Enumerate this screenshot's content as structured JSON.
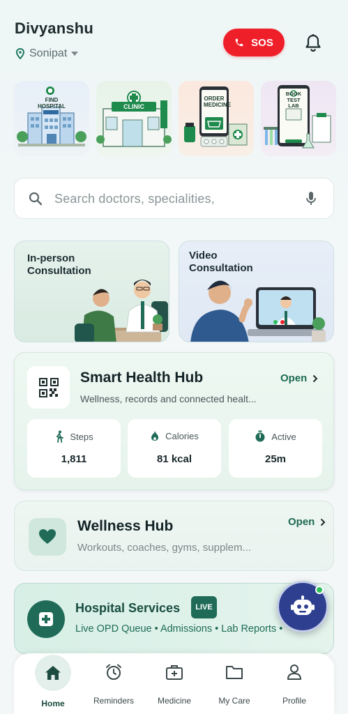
{
  "header": {
    "user_name": "Divyanshu",
    "location": "Sonipat",
    "sos_label": "SOS"
  },
  "services": [
    {
      "label": "FIND HOSPITAL",
      "icon": "hospital-icon"
    },
    {
      "label": "CLINIC",
      "icon": "clinic-icon"
    },
    {
      "label": "ORDER MEDICINE",
      "icon": "medicine-icon"
    },
    {
      "label": "BOOK TEST LAB",
      "icon": "lab-icon"
    }
  ],
  "search": {
    "placeholder": "Search doctors, specialities,"
  },
  "consultations": [
    {
      "title": "In-person Consultation",
      "line1": "In-person",
      "line2": "Consultation"
    },
    {
      "title": "Video Consultation",
      "line1": "Video",
      "line2": "Consultation"
    }
  ],
  "smart_hub": {
    "title": "Smart Health Hub",
    "subtitle": "Wellness, records and connected healt...",
    "open_label": "Open",
    "metrics": [
      {
        "label": "Steps",
        "value": "1,811",
        "icon": "walking-icon"
      },
      {
        "label": "Calories",
        "value": "81 kcal",
        "icon": "flame-icon"
      },
      {
        "label": "Active",
        "value": "25m",
        "icon": "timer-icon"
      }
    ]
  },
  "wellness_hub": {
    "title": "Wellness Hub",
    "subtitle": "Workouts, coaches, gyms, supplem...",
    "open_label": "Open"
  },
  "hospital_services": {
    "title": "Hospital Services",
    "badge": "LIVE",
    "subtitle": "Live OPD Queue • Admissions • Lab Reports •"
  },
  "bottom_nav": [
    {
      "label": "Home",
      "icon": "home-icon",
      "active": true
    },
    {
      "label": "Reminders",
      "icon": "alarm-clock-icon",
      "active": false
    },
    {
      "label": "Medicine",
      "icon": "medkit-icon",
      "active": false
    },
    {
      "label": "My Care",
      "icon": "folder-icon",
      "active": false
    },
    {
      "label": "Profile",
      "icon": "person-icon",
      "active": false
    }
  ],
  "colors": {
    "accent": "#1f6b57",
    "sos": "#ef1f2a",
    "fab": "#2e3f8f",
    "online": "#2fbf5a"
  }
}
